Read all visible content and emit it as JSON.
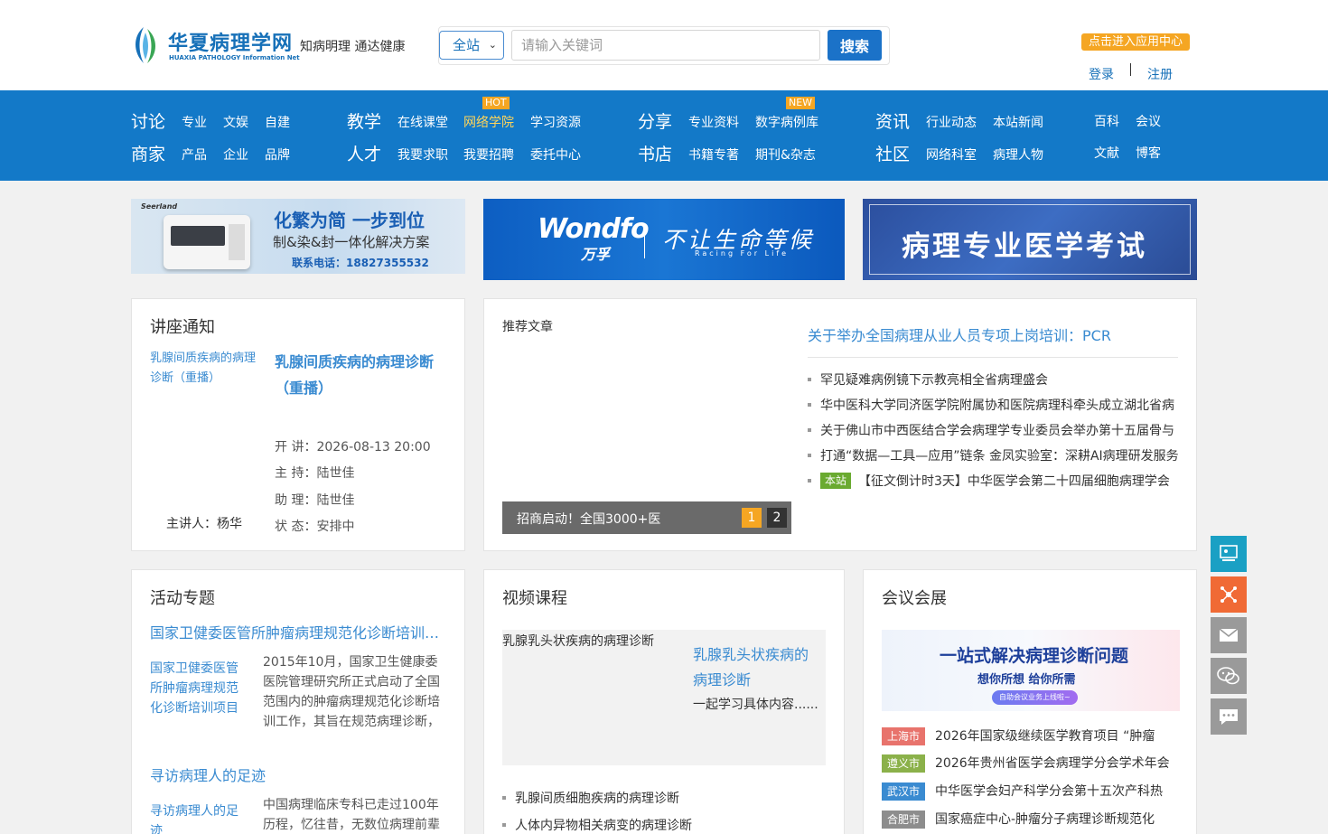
{
  "header": {
    "logo_cn": "华夏病理学网",
    "logo_en": "HUAXIA PATHOLOGY Information Net",
    "slogan": "知病明理 通达健康",
    "search_scope": "全站",
    "search_placeholder": "请输入关键词",
    "search_button": "搜索",
    "app_center": "点击进入应用中心",
    "login": "登录",
    "register": "注册"
  },
  "nav": {
    "groups": [
      {
        "head": "讨论",
        "items": [
          "专业",
          "文娱",
          "自建"
        ]
      },
      {
        "head": "商家",
        "items": [
          "产品",
          "企业",
          "品牌"
        ]
      },
      {
        "head": "教学",
        "items": [
          "在线课堂",
          "网络学院",
          "学习资源"
        ]
      },
      {
        "head": "人才",
        "items": [
          "我要求职",
          "我要招聘",
          "委托中心"
        ]
      },
      {
        "head": "分享",
        "items": [
          "专业资料",
          "数字病例库"
        ]
      },
      {
        "head": "书店",
        "items": [
          "书籍专著",
          "期刊&杂志"
        ]
      },
      {
        "head": "资讯",
        "items": [
          "行业动态",
          "本站新闻"
        ]
      },
      {
        "head": "社区",
        "items": [
          "网络科室",
          "病理人物"
        ]
      }
    ],
    "extra": [
      "百科",
      "会议",
      "文献",
      "博客"
    ],
    "badge_hot": "HOT",
    "badge_new": "NEW"
  },
  "banners": {
    "b1_brand": "Seerland",
    "b1_line1": "化繁为简 一步到位",
    "b1_line2": "制&染&封一体化解决方案",
    "b1_phone": "联系电话：18827355532",
    "b2_brand": "Wondfo",
    "b2_brand_cn": "万孚",
    "b2_slogan": "不让生命等候",
    "b2_sub": "Racing For Life",
    "b3_text": "病理专业医学考试"
  },
  "lecture": {
    "title": "讲座通知",
    "image_alt": "乳腺间质疾病的病理诊断（重播）",
    "name": "乳腺间质疾病的病理诊断（重播）",
    "time": "开 讲：2026-08-13 20:00",
    "host": "主 持：陆世佳",
    "assistant": "助 理：陆世佳",
    "status": "状 态：安排中",
    "speaker": "主讲人：杨华"
  },
  "recommend": {
    "image_alt": "推荐文章",
    "caption": "招商启动！全国3000+医",
    "pages": [
      "1",
      "2"
    ],
    "headline": "关于举办全国病理从业人员专项上岗培训：PCR",
    "items": [
      "罕见疑难病例镜下示教亮相全省病理盛会",
      "华中医科大学同济医学院附属协和医院病理科牵头成立湖北省病",
      "关于佛山市中西医结合学会病理学专业委员会举办第十五届骨与",
      "打通“数据—工具—应用”链条 金凤实验室：深耕AI病理研发服务"
    ],
    "site_badge": "本站",
    "site_item": "【征文倒计时3天】中华医学会第二十四届细胞病理学会"
  },
  "activity": {
    "title": "活动专题",
    "item1_title": "国家卫健委医管所肿瘤病理规范化诊断培训项目",
    "item1_img": "国家卫健委医管所肿瘤病理规范化诊断培训项目",
    "item1_desc": "2015年10月，国家卫生健康委医院管理研究所正式启动了全国范围内的肿瘤病理规范化诊断培训工作，其旨在规范病理诊断，",
    "item2_title": "寻访病理人的足迹",
    "item2_img": "寻访病理人的足迹",
    "item2_desc": "中国病理临床专科已走过100年历程，忆往昔，无数位病理前辈"
  },
  "video": {
    "title": "视频课程",
    "image_alt": "乳腺乳头状疾病的病理诊断",
    "feature_title": "乳腺乳头状疾病的病理诊断",
    "feature_desc": "一起学习具体内容......",
    "items": [
      "乳腺间质细胞疾病的病理诊断",
      "人体内异物相关病变的病理诊断"
    ]
  },
  "meeting": {
    "title": "会议会展",
    "banner_title": "一站式解决病理诊断问题",
    "banner_sub": "想你所想  给你所需",
    "banner_pill": "自助会议业务上线啦~",
    "rows": [
      {
        "city": "上海市",
        "color": "#e8736c",
        "text": "2026年国家级继续医学教育项目 “肿瘤"
      },
      {
        "city": "遵义市",
        "color": "#8bb14a",
        "text": "2026年贵州省医学会病理学分会学术年会"
      },
      {
        "city": "武汉市",
        "color": "#3a8bd1",
        "text": "中华医学会妇产科学分会第十五次产科热"
      },
      {
        "city": "合肥市",
        "color": "#8d8d8d",
        "text": "国家癌症中心-肿瘤分子病理诊断规范化"
      }
    ]
  },
  "tools": [
    {
      "icon": "classroom-icon",
      "color": "#1aa0c4"
    },
    {
      "icon": "share-network-icon",
      "color": "#f06a35"
    },
    {
      "icon": "mail-icon",
      "color": "#9a9a9a"
    },
    {
      "icon": "wechat-icon",
      "color": "#9a9a9a"
    },
    {
      "icon": "chat-icon",
      "color": "#9a9a9a"
    }
  ]
}
